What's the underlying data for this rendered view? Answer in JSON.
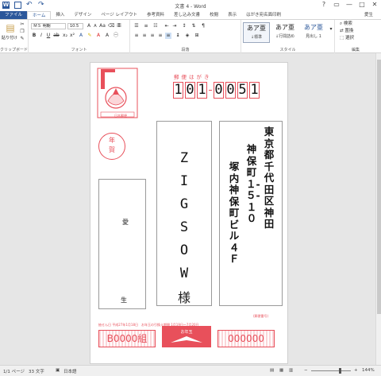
{
  "window": {
    "title": "文書 4 - Word",
    "controls": [
      "?",
      "▭",
      "—",
      "□",
      "✕"
    ]
  },
  "quick_access": {
    "icons": [
      "word-icon",
      "save-icon",
      "undo-icon",
      "redo-icon"
    ]
  },
  "tabs": [
    "ファイル",
    "ホーム",
    "挿入",
    "デザイン",
    "ページ レイアウト",
    "参考資料",
    "差し込み文書",
    "校閲",
    "表示",
    "はがき宛名面印刷"
  ],
  "active_tab": "ホーム",
  "user": "愛生",
  "ribbon": {
    "clipboard": {
      "paste_label": "貼り付け",
      "group_label": "クリップボード"
    },
    "font": {
      "name": "ＭＳ 明朝",
      "size": "10.5",
      "group_label": "フォント"
    },
    "paragraph": {
      "group_label": "段落"
    },
    "styles": {
      "group_label": "スタイル",
      "items": [
        {
          "sample": "あア亜",
          "name": "↓標準"
        },
        {
          "sample": "あア亜",
          "name": "↓行間詰め"
        },
        {
          "sample": "あア亜",
          "name": "見出し 1"
        }
      ]
    },
    "editing": {
      "group_label": "編集",
      "items": [
        "検索",
        "置換",
        "選択"
      ]
    }
  },
  "postcard": {
    "header": "郵便はがき",
    "zip": [
      "1",
      "0",
      "1",
      "0",
      "0",
      "5",
      "1"
    ],
    "stamp_caption": "日本郵便",
    "nenga": "年賀",
    "recipient_name": [
      "Z",
      "I",
      "G",
      "S",
      "O",
      "W"
    ],
    "honorific": "様",
    "address_lines": [
      "東京都千代田区神田",
      "神保町１‐５‐１０",
      "塚内神保町ビル４Ｆ"
    ],
    "sender_name_1": "愛",
    "sender_name_2": "生",
    "lottery_left": "B0000組",
    "lottery_center": "お年玉",
    "lottery_right": "000000",
    "fine_print": "抽せん日 平成27年1月18日　お年玉の引換え期間 1月19日～7月20日",
    "fine_print_right": "(郵便番号)"
  },
  "status": {
    "page": "1/1 ページ",
    "chars": "33 文字",
    "language": "日本語",
    "zoom": "144%",
    "zoom_fraction": 0.72
  }
}
